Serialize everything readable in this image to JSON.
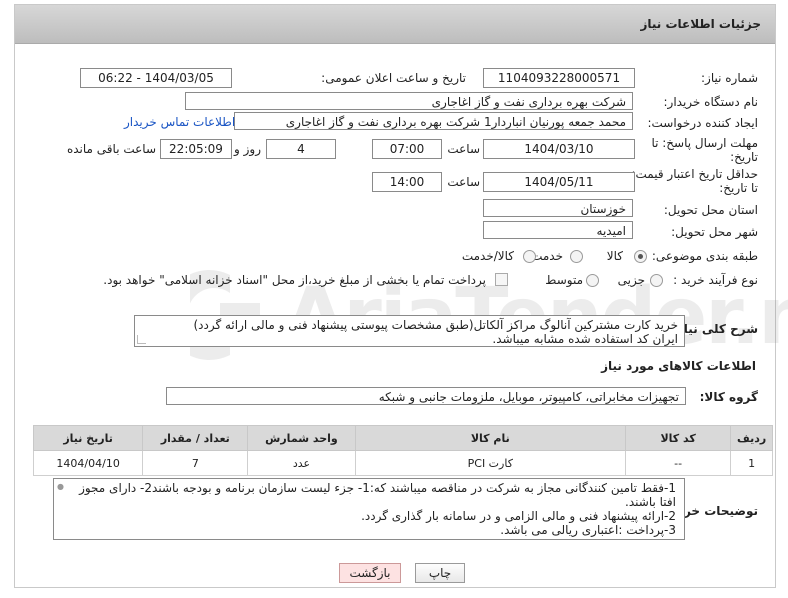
{
  "header": {
    "title": "جزئیات اطلاعات نیاز"
  },
  "need_number": {
    "label": "شماره نیاز:",
    "value": "1104093228000571"
  },
  "announce": {
    "label": "تاریخ و ساعت اعلان عمومی:",
    "value": "1404/03/05 - 06:22"
  },
  "buyer_org": {
    "label": "نام دستگاه خریدار:",
    "value": "شرکت بهره برداری نفت و گاز اغاجاری"
  },
  "creator": {
    "label": "ایجاد کننده درخواست:",
    "value": "محمد جمعه پورنیان انباردار1 شرکت بهره برداری نفت و گاز اغاجاری",
    "contact_link": "اطلاعات تماس خریدار"
  },
  "reply_deadline": {
    "label_1": "مهلت ارسال پاسخ: تا",
    "label_2": "تاریخ:",
    "date": "1404/03/10",
    "time_label": "ساعت",
    "time": "07:00",
    "days": "4",
    "days_label": "روز و",
    "remaining": "22:05:09",
    "remaining_label": "ساعت باقی مانده"
  },
  "price_validity": {
    "label_1": "حداقل تاریخ اعتبار قیمت:",
    "label_2": "تا تاریخ:",
    "date": "1404/05/11",
    "time_label": "ساعت",
    "time": "14:00"
  },
  "delivery_province": {
    "label": "استان محل تحویل:",
    "value": "خوزستان"
  },
  "delivery_city": {
    "label": "شهر محل تحویل:",
    "value": "امیدیه"
  },
  "category": {
    "label": "طبقه بندی موضوعی:",
    "options": [
      "کالا",
      "خدمت",
      "کالا/خدمت"
    ],
    "selected": "کالا"
  },
  "purchase_type": {
    "label": "نوع فرآیند خرید :",
    "options": [
      "جزیی",
      "متوسط"
    ],
    "selected": "",
    "note": "پرداخت تمام یا بخشی از مبلغ خرید،از محل \"اسناد خزانه اسلامی\" خواهد بود."
  },
  "description": {
    "label": "شرح کلی نیاز:",
    "line1": "خرید کارت مشترکین آنالوگ مراکز آلکاتل(طبق مشخصات پیوستی پیشنهاد فنی و مالی ارائه گردد)",
    "line2": "ایران کد استفاده شده مشابه میباشد."
  },
  "goods_section": {
    "title": "اطلاعات کالاهای مورد نیاز"
  },
  "goods_group": {
    "label": "گروه کالا:",
    "value": "تجهیزات مخابراتی، کامپیوتر، موبایل، ملزومات جانبی و شبکه"
  },
  "table": {
    "headers": [
      "ردیف",
      "کد کالا",
      "نام کالا",
      "واحد شمارش",
      "تعداد / مقدار",
      "تاریخ نیاز"
    ],
    "rows": [
      [
        "1",
        "--",
        "کارت PCI",
        "عدد",
        "7",
        "1404/04/10"
      ]
    ]
  },
  "buyer_notes": {
    "label": "توضیحات خریدار:",
    "line1": "1-فقط تامین کنندگانی مجاز به شرکت در مناقصه میباشند که:1- جزء لیست سازمان برنامه و بودجه باشند2- دارای مجوز",
    "line2": "افتا باشند.",
    "line3": "2-ارائه پیشنهاد فنی و مالی الزامی و در سامانه بار گذاری گردد.",
    "line4": "3-پرداخت :اعتباری ریالی  می باشد."
  },
  "buttons": {
    "print": "چاپ",
    "back": "بازگشت"
  },
  "watermark": {
    "text": "AriaTender.neT"
  },
  "colors": {
    "link": "#1a55c4",
    "header_bg": "#c9c9c9",
    "back_button_bg": "#fde2e2"
  }
}
